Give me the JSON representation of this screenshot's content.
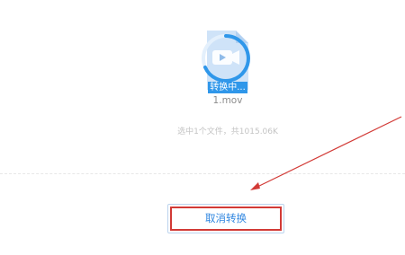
{
  "file": {
    "icon": "video-file-icon",
    "status": "转换中...",
    "name": "1.mov",
    "progress_icon": "spinner-ring-icon"
  },
  "selection_summary": "选中1个文件，共1015.06K",
  "cancel_button": {
    "label": "取消转换"
  },
  "annotation": {
    "icon": "red-arrow-annotation",
    "color": "#d23a36"
  },
  "colors": {
    "accent": "#2f97ea",
    "muted_text": "#8c8c8c",
    "light_text": "#c4c4c4"
  }
}
